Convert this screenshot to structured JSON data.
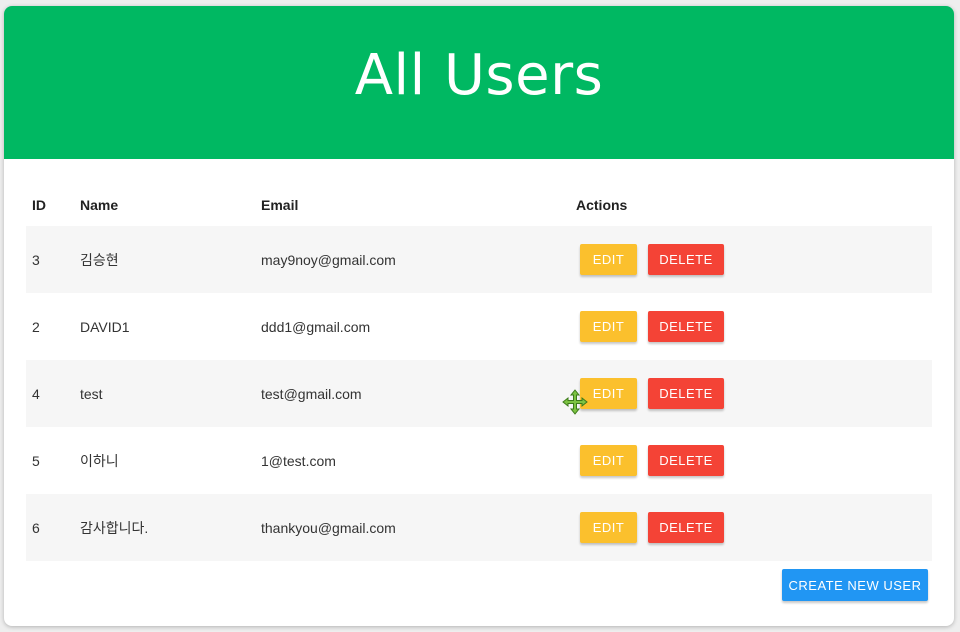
{
  "page": {
    "title": "All Users"
  },
  "colors": {
    "header": "#00b862",
    "edit": "#fbc02d",
    "delete": "#f44336",
    "create": "#2196f3"
  },
  "table": {
    "headers": {
      "id": "ID",
      "name": "Name",
      "email": "Email",
      "actions": "Actions"
    },
    "rows": [
      {
        "id": "3",
        "name": "김승현",
        "email": "may9noy@gmail.com",
        "edit": "EDIT",
        "delete": "DELETE"
      },
      {
        "id": "2",
        "name": "DAVID1",
        "email": "ddd1@gmail.com",
        "edit": "EDIT",
        "delete": "DELETE"
      },
      {
        "id": "4",
        "name": "test",
        "email": "test@gmail.com",
        "edit": "EDIT",
        "delete": "DELETE"
      },
      {
        "id": "5",
        "name": "이하니",
        "email": "1@test.com",
        "edit": "EDIT",
        "delete": "DELETE"
      },
      {
        "id": "6",
        "name": "감사합니다.",
        "email": "thankyou@gmail.com",
        "edit": "EDIT",
        "delete": "DELETE"
      }
    ]
  },
  "actions": {
    "create_label": "CREATE NEW USER"
  },
  "cursor": {
    "icon": "move-cursor-icon"
  }
}
